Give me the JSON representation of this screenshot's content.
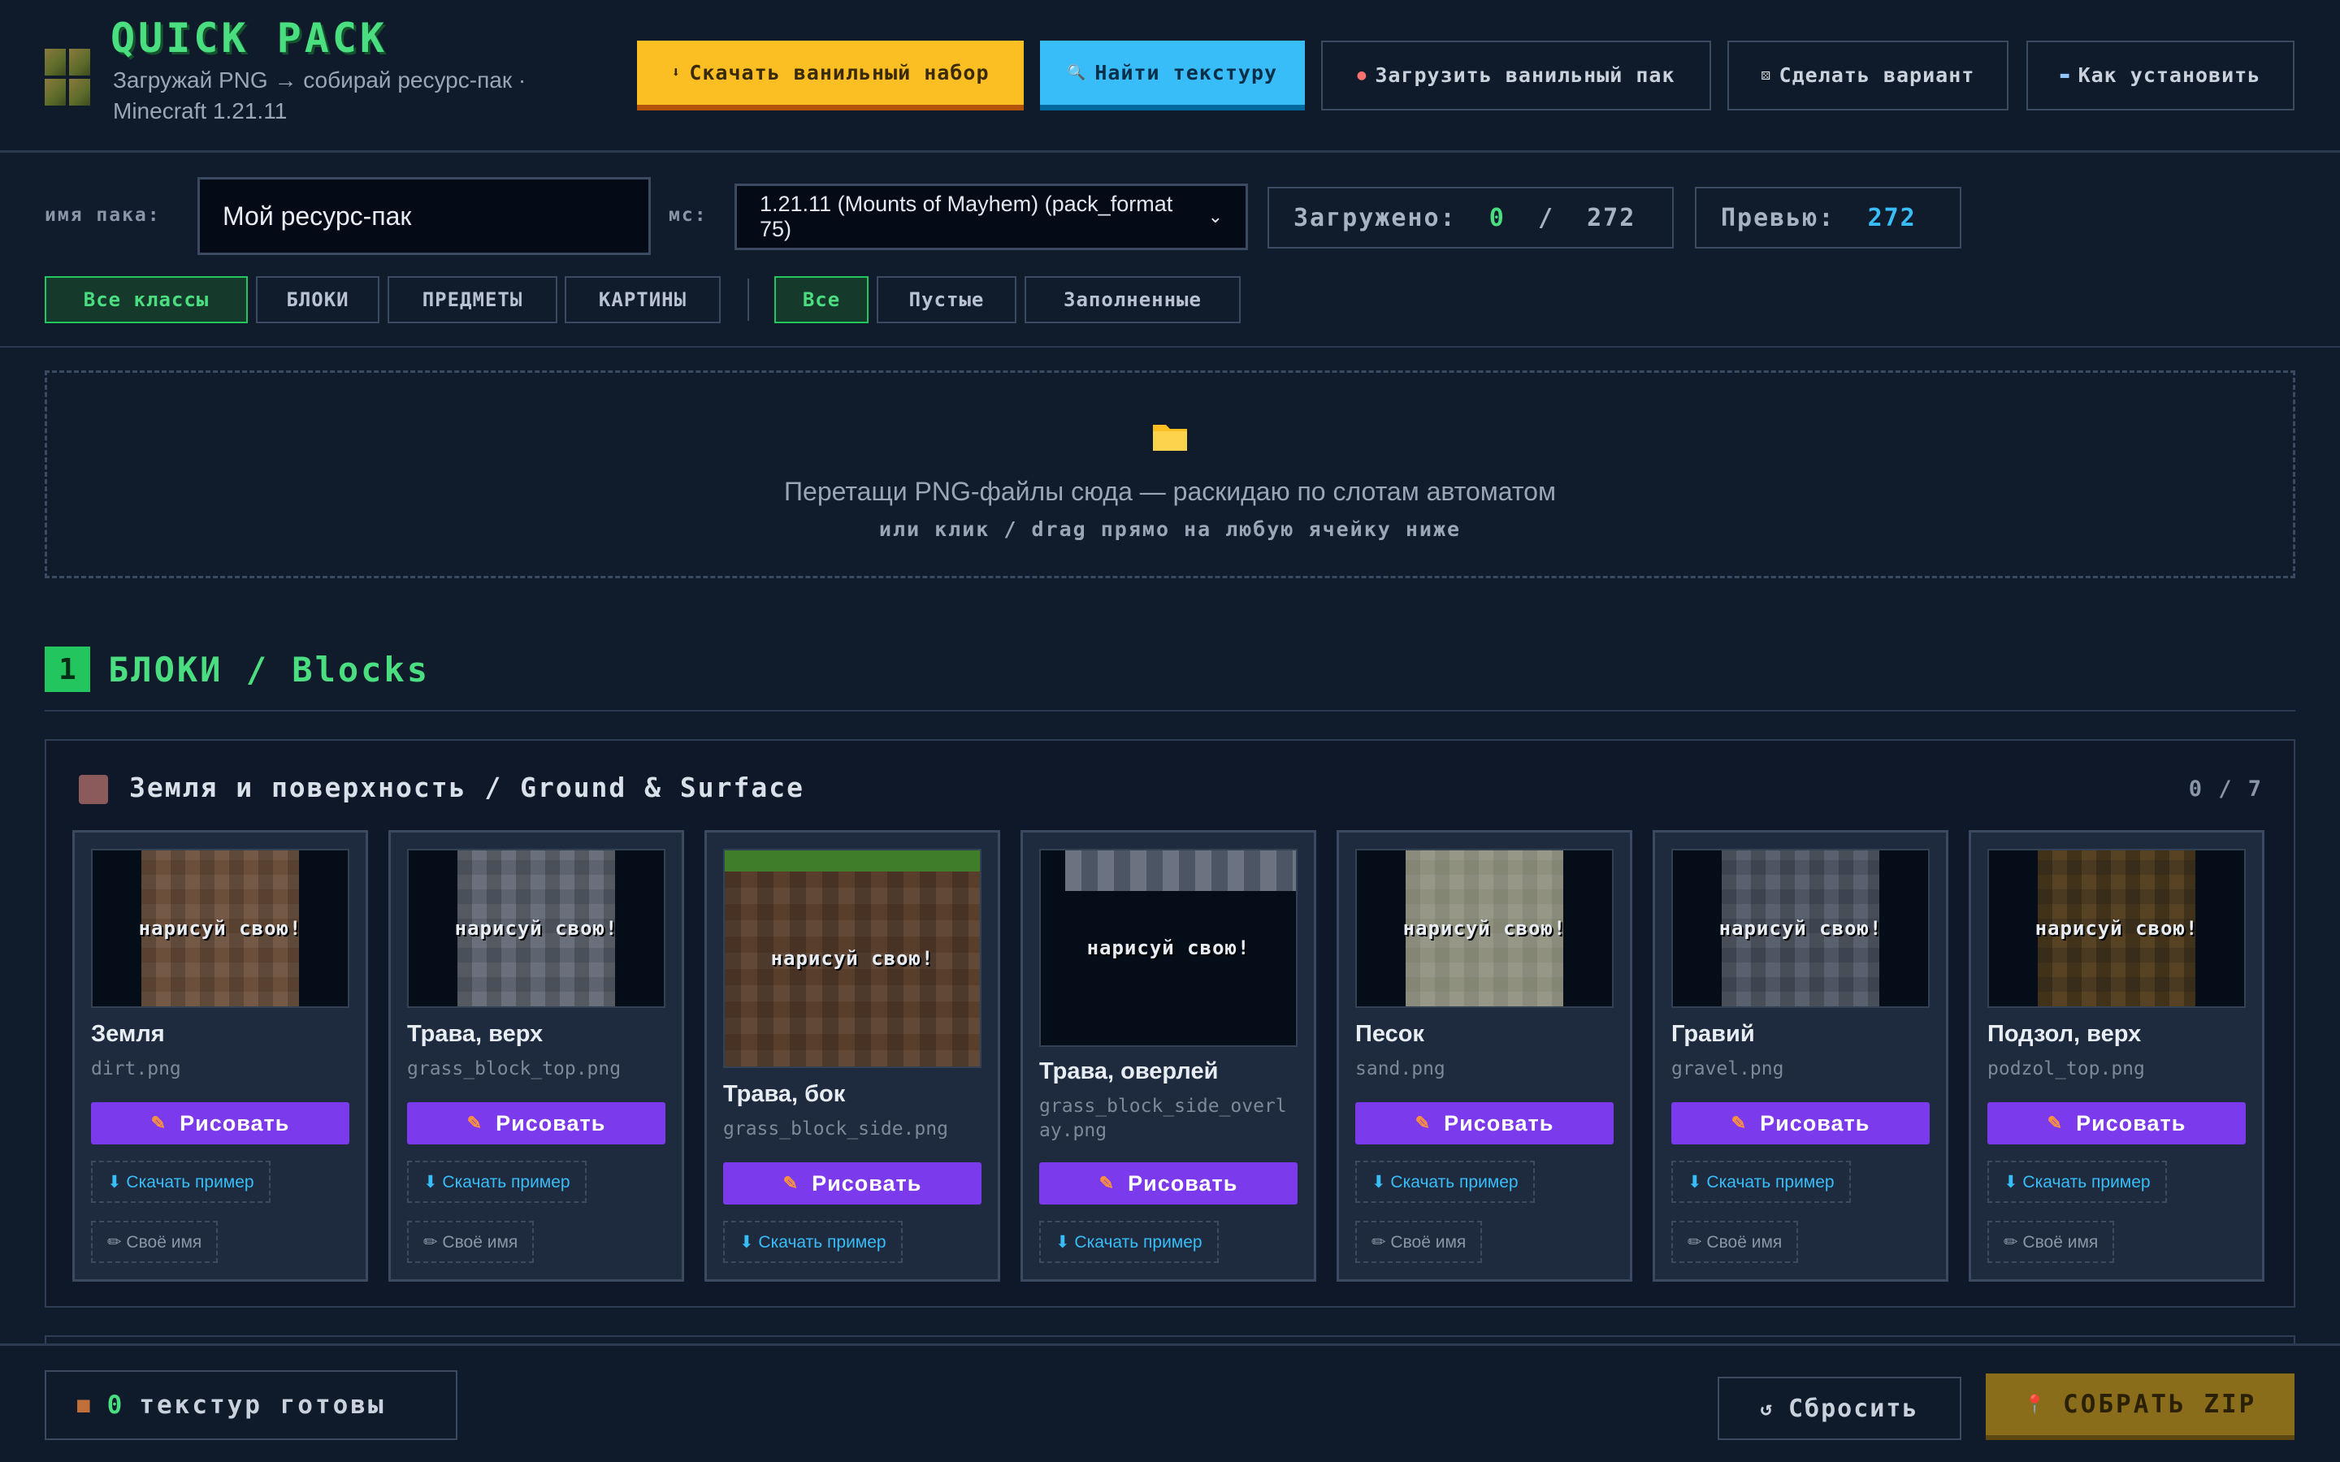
{
  "header": {
    "title": "QUICK PACK",
    "subtitle": "Загружай PNG → собирай ресурс-пак · Minecraft 1.21.11",
    "buttons": {
      "download_vanilla": {
        "icon": "download-icon",
        "label": "Скачать ванильный набор"
      },
      "find_texture": {
        "icon": "search-icon",
        "label": "Найти текстуру"
      },
      "upload_vanilla": {
        "icon": "palette-icon",
        "label": "Загрузить ванильный пак"
      },
      "make_variant": {
        "icon": "dice-icon",
        "label": "Сделать вариант"
      },
      "how_to_install": {
        "icon": "book-icon",
        "label": "Как установить"
      }
    }
  },
  "controls": {
    "pack_name_label": "имя пака:",
    "pack_name_value": "Мой ресурс-пак",
    "mc_label": "мс:",
    "version_selected": "1.21.11 (Mounts of Mayhem) (pack_format 75)",
    "loaded_label": "Загружено:",
    "loaded_count": "0",
    "loaded_sep": "/",
    "loaded_total": "272",
    "preview_label": "Превью:",
    "preview_count": "272"
  },
  "filters": {
    "classes": [
      "Все классы",
      "БЛОКИ",
      "ПРЕДМЕТЫ",
      "КАРТИНЫ"
    ],
    "state": [
      "Все",
      "Пустые",
      "Заполненные"
    ],
    "active_class": "Все классы",
    "active_state": "Все"
  },
  "dropzone": {
    "icon": "folder-icon",
    "text": "Перетащи PNG-файлы сюда — раскидаю по слотам автоматом",
    "subtext": "или клик / drag прямо на любую ячейку ниже"
  },
  "section": {
    "number": "1",
    "title": "БЛОКИ / Blocks"
  },
  "group": {
    "title": "Земля и поверхность / Ground & Surface",
    "count": "0 / 7",
    "color": "#8b5a5a"
  },
  "card_common": {
    "placeholder": "нарисуй свою!",
    "draw_label": "Рисовать",
    "draw_icon": "pencil-icon",
    "example_label": "⬇ Скачать пример",
    "own_name_label": "✏ Своё имя"
  },
  "cards": [
    {
      "name": "Земля",
      "file": "dirt.png"
    },
    {
      "name": "Трава, верх",
      "file": "grass_block_top.png"
    },
    {
      "name": "Трава, бок",
      "file": "grass_block_side.png"
    },
    {
      "name": "Трава, оверлей",
      "file": "grass_block_side_overlay.png"
    },
    {
      "name": "Песок",
      "file": "sand.png"
    },
    {
      "name": "Гравий",
      "file": "gravel.png"
    },
    {
      "name": "Подзол, верх",
      "file": "podzol_top.png"
    }
  ],
  "footer": {
    "ready_icon": "cube-icon",
    "ready_count": "0",
    "ready_text": "текстур готовы",
    "reset_label": "Сбросить",
    "reset_icon": "refresh-icon",
    "zip_label": "СОБРАТЬ ZIP",
    "zip_icon": "pin-icon"
  },
  "colors": {
    "accent_green": "#4ade80",
    "accent_yellow": "#fbbf24",
    "accent_blue": "#38bdf8",
    "accent_purple": "#7c3aed"
  }
}
